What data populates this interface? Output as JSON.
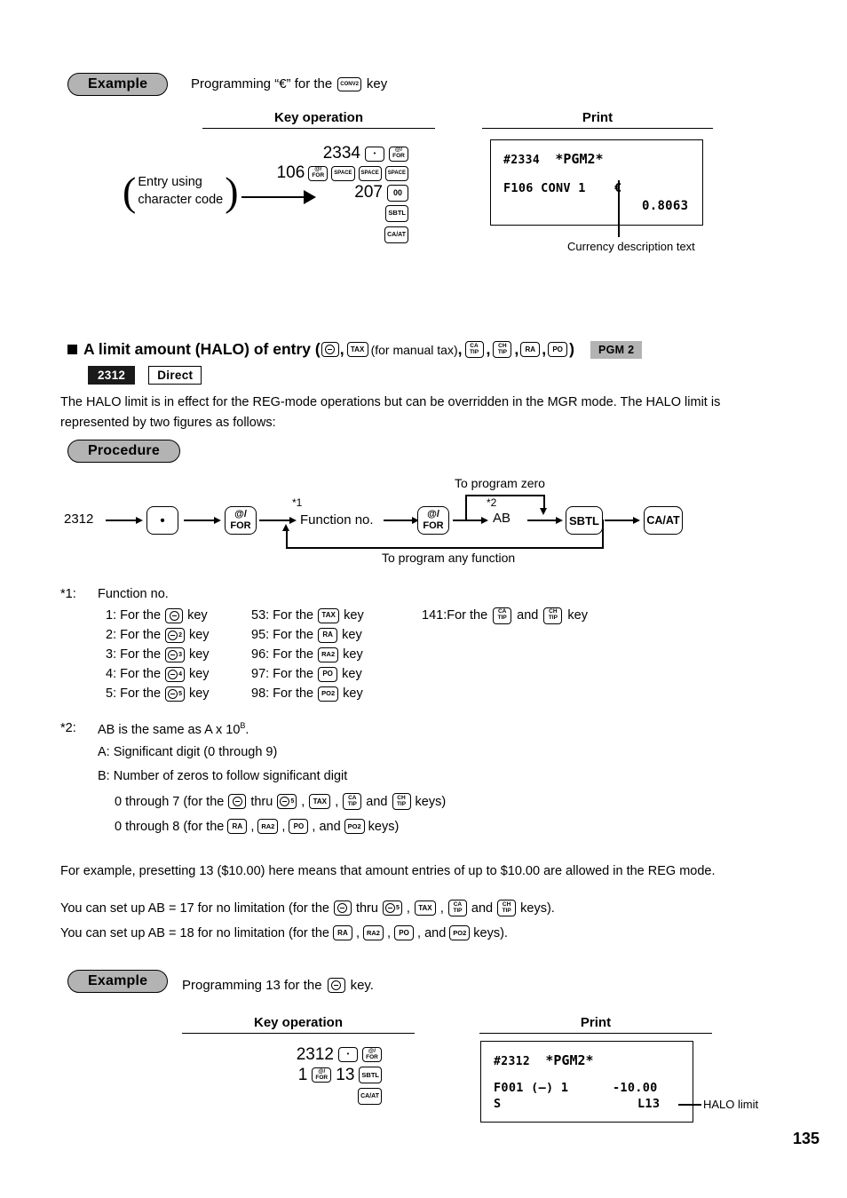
{
  "page": {
    "number": "135"
  },
  "example1": {
    "pill_label": "Example",
    "description_prefix": "Programming “€” for the",
    "description_key": "CONV2",
    "description_suffix": "key",
    "key_operation_header": "Key operation",
    "print_header": "Print",
    "annotation_left_line1": "Entry using",
    "annotation_left_line2": "character code",
    "keys": {
      "row1_num": "2334",
      "row1_k1": "•",
      "row1_k2_l1": "@/",
      "row1_k2_l2": "FOR",
      "row2_num": "106",
      "row2_k1_l1": "@/",
      "row2_k1_l2": "FOR",
      "row2_k2": "SPACE",
      "row2_k3": "SPACE",
      "row2_k4": "SPACE",
      "row3_num": "207",
      "row3_k1": "00",
      "row4_k1": "SBTL",
      "row5_k1": "CA/AT"
    },
    "receipt": {
      "line1_left": "#2334",
      "line1_right": "*PGM2*",
      "line2_left": "F106 CONV 1",
      "line2_mid": "€",
      "line3_right": "0.8063"
    },
    "callout": "Currency description text"
  },
  "section": {
    "title_main": "A limit amount (HALO) of entry (",
    "title_key1": "⊖",
    "title_sep1": ",",
    "title_key2": "TAX",
    "title_note": "(for manual tax)",
    "title_sep2": ",",
    "title_key3_l1": "CA",
    "title_key3_l2": "TIP",
    "title_sep3": ",",
    "title_key4_l1": "CH",
    "title_key4_l2": "TIP",
    "title_sep4": ",",
    "title_key5": "RA",
    "title_sep5": ",",
    "title_key6": "PO",
    "title_close": ")",
    "badge_pgm": "PGM 2",
    "badge_code": "2312",
    "badge_direct": "Direct",
    "paragraph": "The HALO limit is in effect for the REG-mode operations but can be overridden in the MGR mode. The HALO limit is represented by two figures as follows:"
  },
  "procedure": {
    "pill_label": "Procedure",
    "start_number": "2312",
    "key_dot": "•",
    "key_for_l1": "@/",
    "key_for_l2": "FOR",
    "star1": "*1",
    "function_no": "Function no.",
    "key_for2_l1": "@/",
    "key_for2_l2": "FOR",
    "star2": "*2",
    "ab": "AB",
    "key_sbtl": "SBTL",
    "key_caat": "CA/AT",
    "label_zero": "To program zero",
    "label_any": "To program any function"
  },
  "footnote1": {
    "marker": "*1:",
    "title": "Function no.",
    "col1": [
      {
        "num": "1: For the",
        "key": "⊖",
        "keysub": "",
        "suffix": "key"
      },
      {
        "num": "2: For the",
        "key": "⊖",
        "keysub": "2",
        "suffix": "key"
      },
      {
        "num": "3: For the",
        "key": "⊖",
        "keysub": "3",
        "suffix": "key"
      },
      {
        "num": "4: For the",
        "key": "⊖",
        "keysub": "4",
        "suffix": "key"
      },
      {
        "num": "5: For the",
        "key": "⊖",
        "keysub": "5",
        "suffix": "key"
      }
    ],
    "col2": [
      {
        "num": "53: For the",
        "key": "TAX",
        "suffix": "key"
      },
      {
        "num": "95: For the",
        "key": "RA",
        "suffix": "key"
      },
      {
        "num": "96: For the",
        "key": "RA2",
        "suffix": "key"
      },
      {
        "num": "97: For the",
        "key": "PO",
        "suffix": "key"
      },
      {
        "num": "98: For the",
        "key": "PO2",
        "suffix": "key"
      }
    ],
    "col3": {
      "prefix": "141:For the",
      "key1_l1": "CA",
      "key1_l2": "TIP",
      "mid": "and",
      "key2_l1": "CH",
      "key2_l2": "TIP",
      "suffix": "key"
    }
  },
  "footnote2": {
    "marker": "*2:",
    "line1_a": "AB is the same as A x 10",
    "line1_sup": "B",
    "line1_b": ".",
    "line2": "A: Significant digit (0 through 9)",
    "line3": "B: Number of zeros to follow significant digit",
    "line4_a": "0 through 7 (for the",
    "line4_thru": "thru",
    "line4_and": "and",
    "line4_end": "keys)",
    "line5_a": "0 through 8 (for the",
    "line5_and": ", and",
    "line5_end": "keys)",
    "keys": {
      "minus": "⊖",
      "minus5_sub": "5",
      "tax": "TAX",
      "catip_l1": "CA",
      "catip_l2": "TIP",
      "chtip_l1": "CH",
      "chtip_l2": "TIP",
      "ra": "RA",
      "ra2": "RA2",
      "po": "PO",
      "po2": "PO2"
    }
  },
  "explain": {
    "para1": "For example, presetting 13 ($10.00) here means that amount entries of up to $10.00 are allowed in the REG mode.",
    "para2_a": "You can set up AB = 17 for no limitation (for the",
    "para2_thru": "thru",
    "para2_and": "and",
    "para2_end": "keys).",
    "para3_a": "You can set up AB = 18 for no limitation (for the",
    "para3_and": ", and",
    "para3_end": "keys)."
  },
  "example2": {
    "pill_label": "Example",
    "description_prefix": "Programming 13 for the",
    "description_key": "⊖",
    "description_suffix": "key.",
    "key_operation_header": "Key operation",
    "print_header": "Print",
    "keys": {
      "row1_num": "2312",
      "row1_k1": "•",
      "row1_k2_l1": "@/",
      "row1_k2_l2": "FOR",
      "row2_num1": "1",
      "row2_k1_l1": "@/",
      "row2_k1_l2": "FOR",
      "row2_num2": "13",
      "row2_k2": "SBTL",
      "row3_k1": "CA/AT"
    },
    "receipt": {
      "line1_left": "#2312",
      "line1_right": "*PGM2*",
      "line2_left": "F001 (—) 1",
      "line2_right": "-10.00",
      "line3_left": "S",
      "line3_right": "L13"
    },
    "callout": "HALO limit"
  }
}
